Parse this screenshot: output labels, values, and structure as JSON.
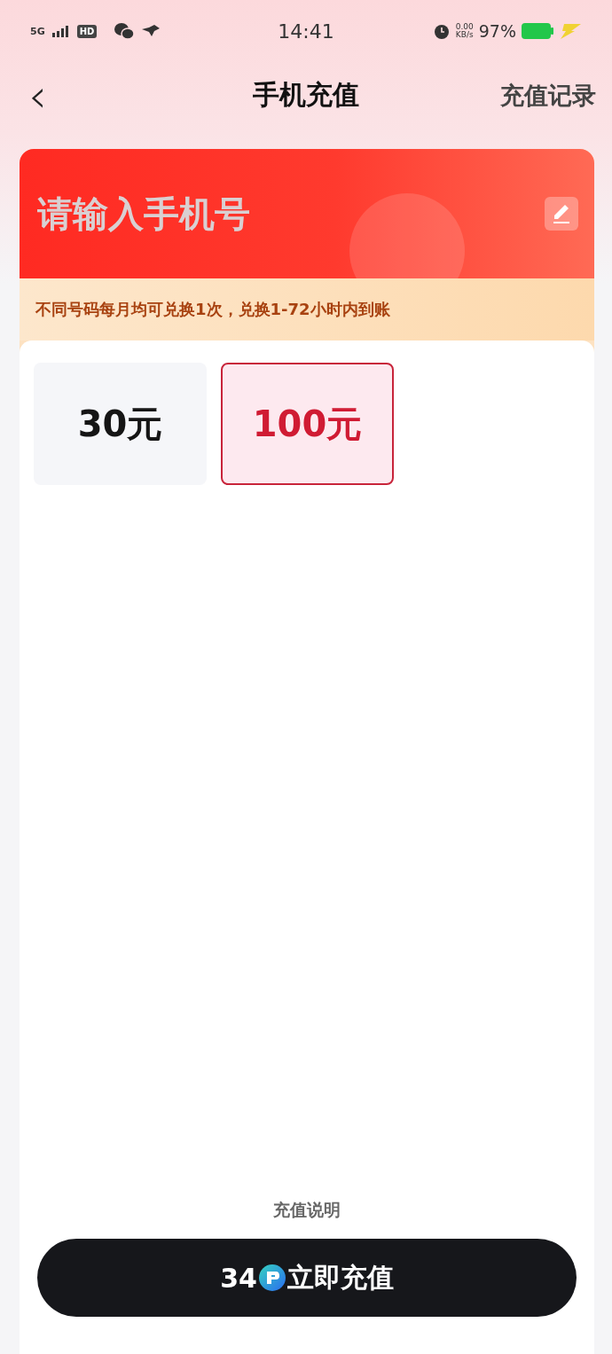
{
  "status_bar": {
    "network": "5G",
    "hd": "HD",
    "time": "14:41",
    "speed_value": "0.00",
    "speed_unit": "KB/s",
    "battery": "97%"
  },
  "nav": {
    "back": "‹",
    "title": "手机充值",
    "action": "充值记录"
  },
  "phone_field": {
    "placeholder": "请输入手机号"
  },
  "notice": "不同号码每月均可兑换1次，兑换1-72小时内到账",
  "amounts": [
    {
      "label": "30元",
      "selected": false
    },
    {
      "label": "100元",
      "selected": true
    }
  ],
  "info_link": "充值说明",
  "pay_button": {
    "price": "34",
    "label": "立即充值"
  }
}
